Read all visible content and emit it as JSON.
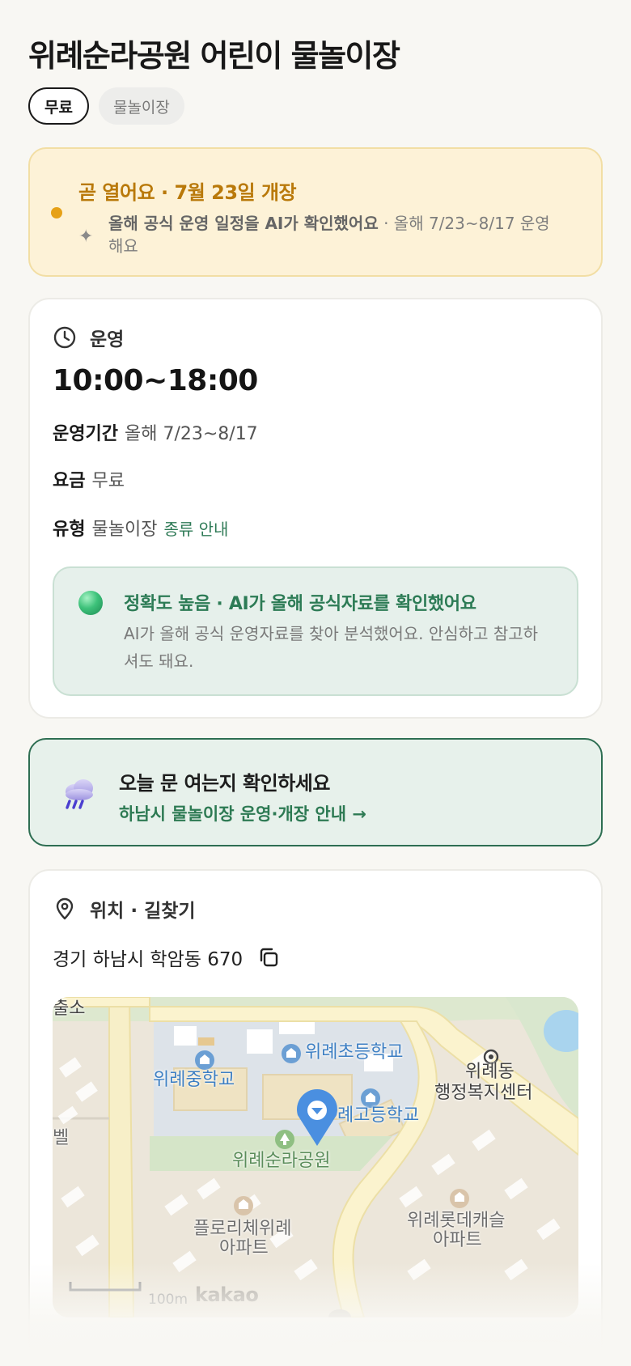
{
  "header": {
    "title": "위례순라공원 어린이 물놀이장",
    "chips": {
      "price": "무료",
      "type": "물놀이장"
    }
  },
  "notice": {
    "title": "곧 열어요 · 7월 23일 개장",
    "ai_lead": "올해 공식 운영 일정을 AI가 확인했어요",
    "ai_detail": " · 올해 7/23~8/17 운영해요",
    "accent_color": "#e6a117"
  },
  "operation": {
    "section_label": "운영",
    "hours": "10:00~18:00",
    "period_label": "운영기간",
    "period_value": "올해 7/23~8/17",
    "fee_label": "요금",
    "fee_value": "무료",
    "type_label": "유형",
    "type_value": "물놀이장",
    "type_link": "종류 안내",
    "accuracy": {
      "title": "정확도 높음 · AI가 올해 공식자료를 확인했어요",
      "text": "AI가 올해 공식 운영자료를 찾아 분석했어요. 안심하고 참고하셔도 돼요."
    }
  },
  "today_check": {
    "title": "오늘 문 여는지 확인하세요",
    "link": "하남시 물놀이장 운영·개장 안내 →",
    "icon": "rain-cloud-icon"
  },
  "location": {
    "section_label": "위치 · 길찾기",
    "address": "경기 하남시 학암동 670",
    "map": {
      "labels": {
        "l_top_cut": "출소",
        "wirye_middle": "위례중학교",
        "wirye_elem": "위례초등학교",
        "wirye_high": "례고등학교",
        "wirye_dong": "위례동",
        "wirye_center": "행정복지센터",
        "park": "위례순라공원",
        "edge_cut": "벨",
        "florice_1": "플로리체위례",
        "florice_2": "아파트",
        "lotte_1": "위례롯데캐슬",
        "lotte_2": "아파트"
      },
      "scale": "100m",
      "provider": "kakao"
    }
  }
}
